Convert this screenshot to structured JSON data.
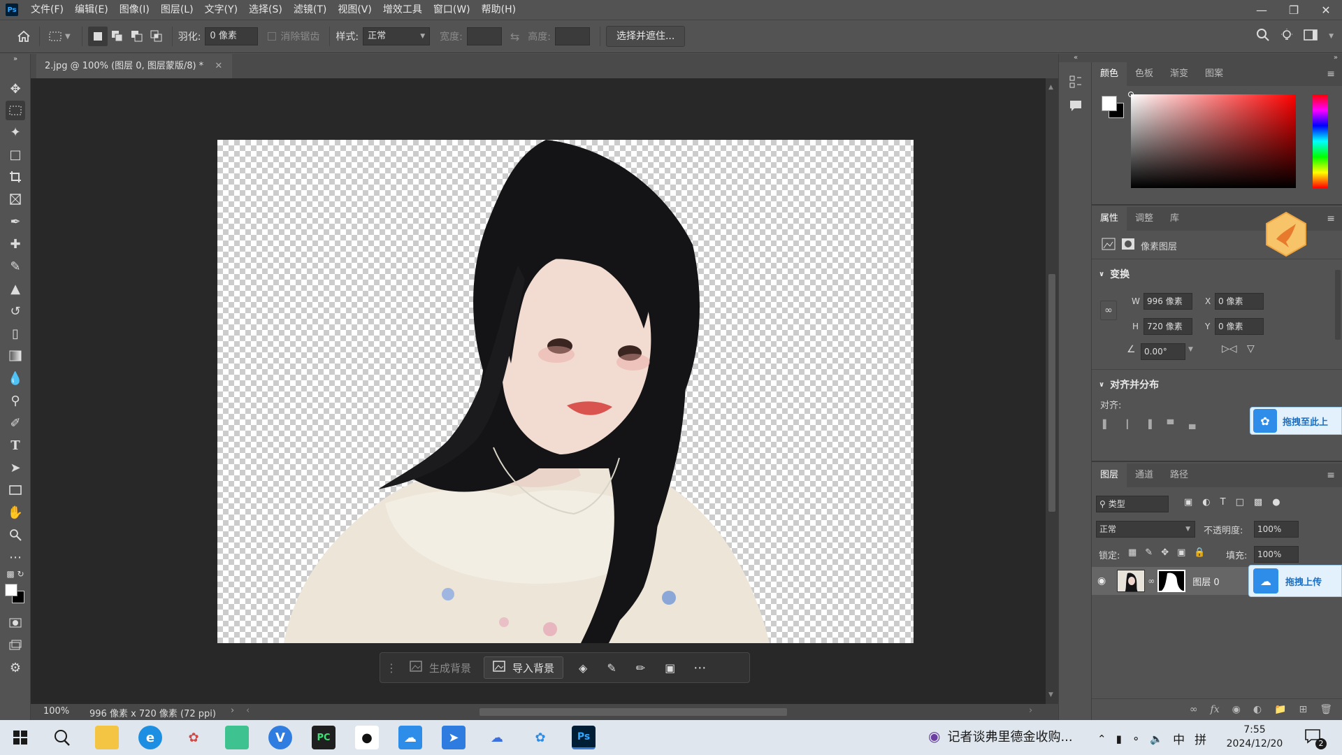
{
  "menubar": {
    "logo": "Ps",
    "items": [
      "文件(F)",
      "编辑(E)",
      "图像(I)",
      "图层(L)",
      "文字(Y)",
      "选择(S)",
      "滤镜(T)",
      "视图(V)",
      "增效工具",
      "窗口(W)",
      "帮助(H)"
    ]
  },
  "options": {
    "feather_label": "羽化:",
    "feather_value": "0 像素",
    "antialias_label": "消除锯齿",
    "style_label": "样式:",
    "style_value": "正常",
    "width_label": "宽度:",
    "height_label": "高度:",
    "select_mask_button": "选择并遮住..."
  },
  "document": {
    "tab_title": "2.jpg @ 100% (图层 0, 图层蒙版/8) *",
    "zoom": "100%",
    "dimensions": "996 像素 x 720 像素 (72 ppi)"
  },
  "context_bar": {
    "generate_bg": "生成背景",
    "import_bg": "导入背景"
  },
  "color_panel": {
    "tabs": [
      "颜色",
      "色板",
      "渐变",
      "图案"
    ]
  },
  "properties_panel": {
    "tabs": [
      "属性",
      "调整",
      "库"
    ],
    "layer_type": "像素图层",
    "transform_title": "变换",
    "w_label": "W",
    "w_value": "996 像素",
    "h_label": "H",
    "h_value": "720 像素",
    "x_label": "X",
    "x_value": "0 像素",
    "y_label": "Y",
    "y_value": "0 像素",
    "angle_value": "0.00°",
    "align_title": "对齐并分布",
    "align_label": "对齐:",
    "drag_overlay_1": "拖拽至此上",
    "drag_overlay_2": "拖拽上传"
  },
  "layers_panel": {
    "tabs": [
      "图层",
      "通道",
      "路径"
    ],
    "filter_kind": "类型",
    "blend_mode": "正常",
    "opacity_label": "不透明度:",
    "opacity_value": "100%",
    "lock_label": "锁定:",
    "fill_label": "填充:",
    "fill_value": "100%",
    "layer_name": "图层 0"
  },
  "taskbar": {
    "news_text": "记者谈弗里德金收购...",
    "ime_lang": "中",
    "ime_mode": "拼",
    "time": "7:55",
    "date": "2024/12/20",
    "notif_count": "2"
  }
}
